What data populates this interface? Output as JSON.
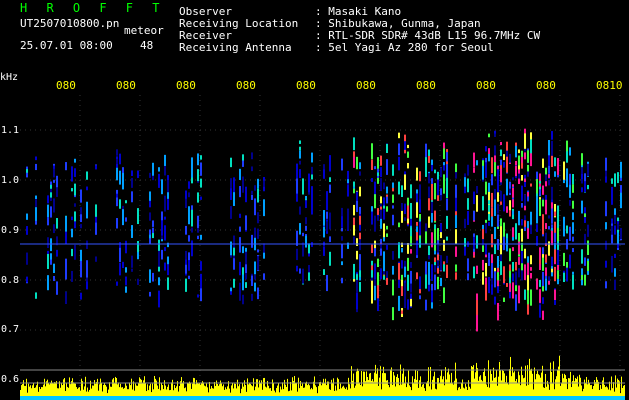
{
  "header": {
    "title": "H R O F F T",
    "file_name": "UT2507010800.pn",
    "label_meteor": "meteor",
    "datetime": "25.07.01 08:00",
    "count": "48",
    "fields": [
      {
        "key": "Observer",
        "value": ": Masaki Kano"
      },
      {
        "key": "Receiving Location",
        "value": ": Shibukawa, Gunma, Japan"
      },
      {
        "key": "Receiver",
        "value": ": RTL-SDR SDR# 43dB L15 96.7MHz CW"
      },
      {
        "key": "Receiving Antenna",
        "value": ": 5el Yagi Az 280 for Seoul"
      }
    ]
  },
  "axis": {
    "y_unit": "kHz",
    "y_ticks": [
      "1.1",
      "1.0",
      "0.9",
      "0.8",
      "0.7",
      "0.6"
    ],
    "x_ticks": [
      "080",
      "080",
      "080",
      "080",
      "080",
      "080",
      "080",
      "080",
      "080",
      "0810"
    ]
  },
  "colors": {
    "background": "#000000",
    "title": "#00ff00",
    "axis_text": "#ffffff",
    "time_labels": "#ffff00",
    "spectrum_low": "#0000aa",
    "spectrum_high": "#ff0080",
    "power_trace": "#ffff00",
    "baseline": "#00ffff"
  }
}
